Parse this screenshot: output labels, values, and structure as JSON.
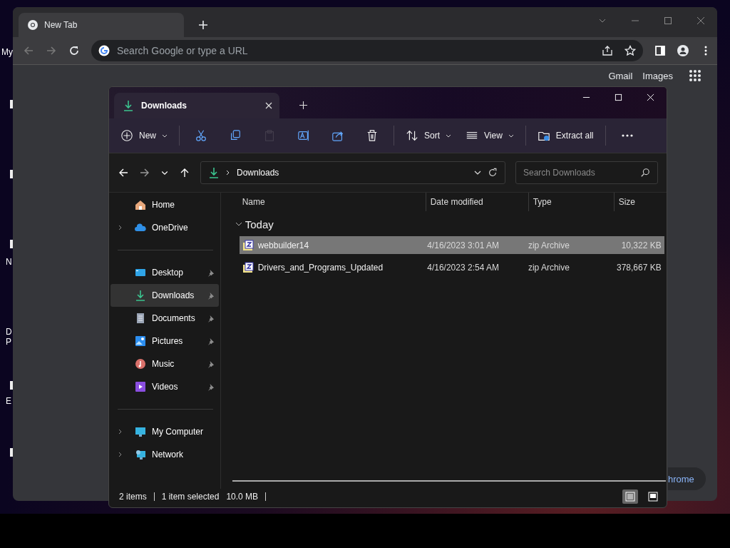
{
  "desktop": {
    "icon_labels": [
      "My",
      "N",
      "D",
      "P",
      "E"
    ]
  },
  "browser": {
    "tab": {
      "title": "New Tab"
    },
    "omnibox": {
      "placeholder": "Search Google or type a URL"
    },
    "links": [
      "Gmail",
      "Images"
    ],
    "customize_button": "hrome"
  },
  "explorer": {
    "tab": {
      "title": "Downloads"
    },
    "toolbar_groups": [
      [
        {
          "label": "New",
          "dropdown": true,
          "disabled": false
        }
      ],
      [
        {
          "disabled": false
        },
        {
          "disabled": false
        },
        {
          "disabled": true
        },
        {
          "disabled": false
        },
        {
          "disabled": false
        },
        {
          "disabled": false
        }
      ],
      [
        {
          "label": "Sort",
          "dropdown": true,
          "disabled": false
        },
        {
          "label": "View",
          "dropdown": true,
          "disabled": false
        }
      ],
      [
        {
          "label": "Extract all",
          "dropdown": false,
          "disabled": false
        }
      ],
      [
        {
          "disabled": false
        }
      ]
    ],
    "address": {
      "location": "Downloads"
    },
    "search": {
      "placeholder": "Search Downloads"
    },
    "nav_groups": [
      [
        {
          "label": "Home",
          "expandable": false,
          "pinned": false,
          "selected": false
        },
        {
          "label": "OneDrive",
          "expandable": true,
          "pinned": false,
          "selected": false
        }
      ],
      [
        {
          "label": "Desktop",
          "expandable": false,
          "pinned": true,
          "selected": false
        },
        {
          "label": "Downloads",
          "expandable": false,
          "pinned": true,
          "selected": true
        },
        {
          "label": "Documents",
          "expandable": false,
          "pinned": true,
          "selected": false
        },
        {
          "label": "Pictures",
          "expandable": false,
          "pinned": true,
          "selected": false
        },
        {
          "label": "Music",
          "expandable": false,
          "pinned": true,
          "selected": false
        },
        {
          "label": "Videos",
          "expandable": false,
          "pinned": true,
          "selected": false
        }
      ],
      [
        {
          "label": "My Computer",
          "expandable": true,
          "pinned": false,
          "selected": false
        },
        {
          "label": "Network",
          "expandable": true,
          "pinned": false,
          "selected": false
        }
      ]
    ],
    "columns": [
      "Name",
      "Date modified",
      "Type",
      "Size"
    ],
    "group": {
      "label": "Today",
      "expanded": true
    },
    "rows": [
      {
        "name": "webbuilder14",
        "date": "4/16/2023 3:01 AM",
        "type": "zip Archive",
        "size": "10,322 KB",
        "selected": true
      },
      {
        "name": "Drivers_and_Programs_Updated",
        "date": "4/16/2023 2:54 AM",
        "type": "zip Archive",
        "size": "378,667 KB",
        "selected": false
      }
    ],
    "status": {
      "count": "2 items",
      "selection": "1 item selected",
      "size": "10.0 MB"
    },
    "view_buttons": [
      {
        "selected": true
      },
      {
        "selected": false
      }
    ]
  }
}
